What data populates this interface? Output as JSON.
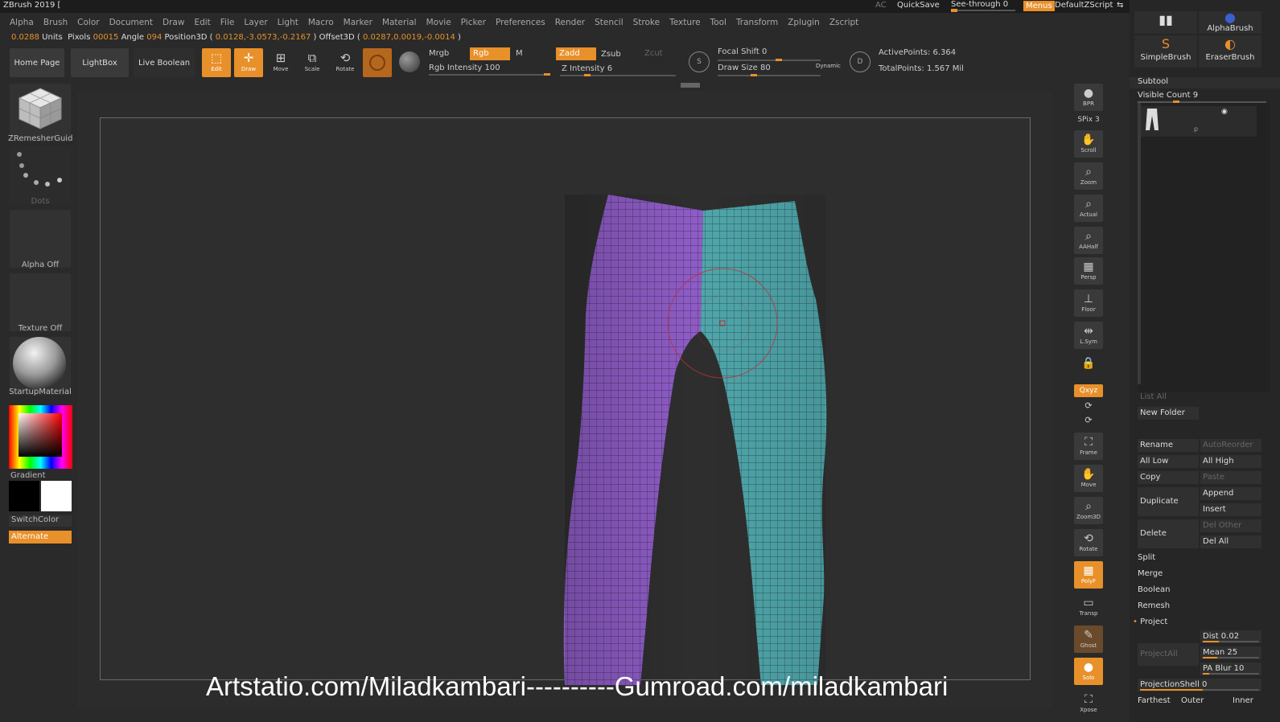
{
  "titlebar": {
    "app_title": "ZBrush 2019 [",
    "ac": "AC",
    "quicksave": "QuickSave",
    "see_through": "See-through  0",
    "see_through_value": 0,
    "menus": "Menus",
    "default_zscript": "DefaultZScript"
  },
  "menubar": [
    "Alpha",
    "Brush",
    "Color",
    "Document",
    "Draw",
    "Edit",
    "File",
    "Layer",
    "Light",
    "Macro",
    "Marker",
    "Material",
    "Movie",
    "Picker",
    "Preferences",
    "Render",
    "Stencil",
    "Stroke",
    "Texture",
    "Tool",
    "Transform",
    "Zplugin",
    "Zscript"
  ],
  "infobar": {
    "units_value": "0.0288",
    "units_label": " Units",
    "pixols_label": "Pixols ",
    "pixols_value": "00015",
    "angle_label": " Angle ",
    "angle_value": "094",
    "position_label": " Position3D ( ",
    "position_value": "0.0128,-3.0573,-0.2167",
    "offset_label": " ) Offset3D ( ",
    "offset_value": "0.0287,0.0019,-0.0014",
    "close": " )"
  },
  "toolbar": {
    "home_page": "Home Page",
    "lightbox": "LightBox",
    "live_boolean": "Live Boolean",
    "edit": "Edit",
    "draw": "Draw",
    "move": "Move",
    "scale": "Scale",
    "rotate": "Rotate",
    "mrgb": "Mrgb",
    "rgb": "Rgb",
    "m": "M",
    "rgb_intensity": "Rgb Intensity 100",
    "rgb_intensity_value": 100,
    "zadd": "Zadd",
    "zsub": "Zsub",
    "zcut": "Zcut",
    "z_intensity": "Z Intensity 6",
    "z_intensity_value": 6,
    "focal_shift": "Focal Shift 0",
    "draw_size": "Draw Size 80",
    "dynamic": "Dynamic",
    "active_points": "ActivePoints: 6.364",
    "total_points": "TotalPoints: 1.567 Mil"
  },
  "leftpanel": {
    "zremesher_guide": "ZRemesherGuid",
    "dots": "Dots",
    "alpha_off": "Alpha Off",
    "texture_off": "Texture Off",
    "startup_material": "StartupMaterial",
    "gradient": "Gradient",
    "switch_color": "SwitchColor",
    "alternate": "Alternate"
  },
  "rightshelf": {
    "bpr": "BPR",
    "spix": "SPix 3",
    "scroll": "Scroll",
    "zoom": "Zoom",
    "actual": "Actual",
    "aahalf": "AAHalf",
    "persp": "Persp",
    "floor": "Floor",
    "lsym": "L.Sym",
    "xyz": "Qxyz",
    "frame": "Frame",
    "move": "Move",
    "zoom3d": "Zoom3D",
    "rotate": "Rotate",
    "polyf": "PolyF",
    "transp": "Transp",
    "ghost": "Ghost",
    "solo": "Solo",
    "xpose": "Xpose"
  },
  "rightpanel": {
    "alpha_brush": "AlphaBrush",
    "simple_brush": "SimpleBrush",
    "eraser_brush": "EraserBrush",
    "subtool": "Subtool",
    "visible_count": "Visible Count 9",
    "list_all": "List All",
    "new_folder": "New Folder",
    "rename": "Rename",
    "auto_reorder": "AutoReorder",
    "all_low": "All Low",
    "all_high": "All High",
    "copy": "Copy",
    "paste": "Paste",
    "append": "Append",
    "duplicate": "Duplicate",
    "insert": "Insert",
    "del_other": "Del Other",
    "delete": "Delete",
    "del_all": "Del All",
    "split": "Split",
    "merge": "Merge",
    "boolean": "Boolean",
    "remesh": "Remesh",
    "project": "Project",
    "dist": "Dist 0.02",
    "mean": "Mean 25",
    "projectall": "ProjectAll",
    "pa_blur": "PA Blur 10",
    "projection_shell": "ProjectionShell 0",
    "farthest": "Farthest",
    "outer": "Outer",
    "inner": "Inner"
  },
  "watermark": "Artstatio.com/Miladkambari----------Gumroad.com/miladkambari",
  "colors": {
    "accent": "#e8902a",
    "left_leg": "#8e5cc6",
    "right_leg": "#4fa7ab"
  }
}
